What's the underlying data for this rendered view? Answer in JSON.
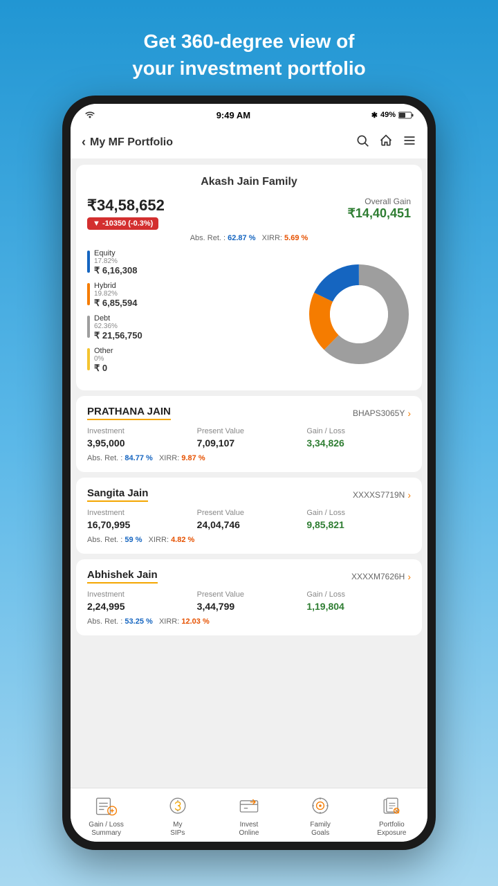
{
  "header": {
    "line1": "Get 360-degree view of",
    "line2": "your investment portfolio"
  },
  "statusBar": {
    "time": "9:49 AM",
    "battery": "49%",
    "wifi": "wifi",
    "bluetooth": "BT"
  },
  "nav": {
    "back": "‹",
    "title": "My MF Portfolio"
  },
  "portfolio": {
    "familyName": "Akash Jain Family",
    "totalValue": "₹34,58,652",
    "change": "▼ -10350  (-0.3%)",
    "overallGainLabel": "Overall Gain",
    "overallGainValue": "₹14,40,451",
    "absRet": "62.87 %",
    "xirr": "5.69 %"
  },
  "legend": [
    {
      "color": "#1565c0",
      "name": "Equity",
      "pct": "17.82%",
      "amount": "₹ 6,16,308"
    },
    {
      "color": "#f57c00",
      "name": "Hybrid",
      "pct": "19.82%",
      "amount": "₹ 6,85,594"
    },
    {
      "color": "#9e9e9e",
      "name": "Debt",
      "pct": "62.36%",
      "amount": "₹ 21,56,750"
    },
    {
      "color": "#f4c430",
      "name": "Other",
      "pct": "0%",
      "amount": "₹ 0"
    }
  ],
  "members": [
    {
      "name": "PRATHANA JAIN",
      "pan": "BHAPS3065Y",
      "investment": "3,95,000",
      "presentValue": "7,09,107",
      "gainLoss": "3,34,826",
      "absRet": "84.77 %",
      "xirr": "9.87 %"
    },
    {
      "name": "Sangita Jain",
      "pan": "XXXXS7719N",
      "investment": "16,70,995",
      "presentValue": "24,04,746",
      "gainLoss": "9,85,821",
      "absRet": "59 %",
      "xirr": "4.82 %"
    },
    {
      "name": "Abhishek Jain",
      "pan": "XXXXM7626H",
      "investment": "2,24,995",
      "presentValue": "3,44,799",
      "gainLoss": "1,19,804",
      "absRet": "53.25 %",
      "xirr": "12.03 %"
    }
  ],
  "bottomNav": [
    {
      "id": "gain-loss",
      "label": "Gain / Loss\nSummary"
    },
    {
      "id": "my-sips",
      "label": "My\nSIPs"
    },
    {
      "id": "invest-online",
      "label": "Invest\nOnline"
    },
    {
      "id": "family-goals",
      "label": "Family\nGoals"
    },
    {
      "id": "portfolio-exposure",
      "label": "Portfolio\nExposure"
    }
  ]
}
